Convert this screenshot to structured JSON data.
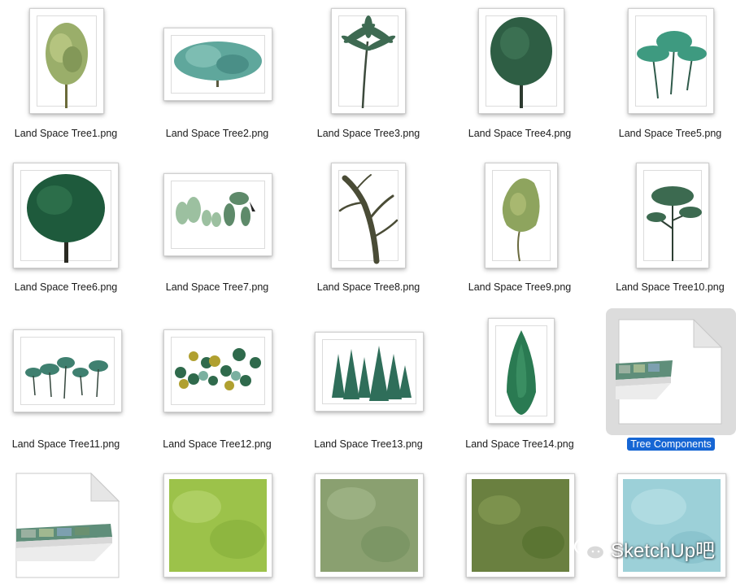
{
  "files": [
    {
      "name": "Land Space Tree1.png"
    },
    {
      "name": "Land Space Tree2.png"
    },
    {
      "name": "Land Space Tree3.png"
    },
    {
      "name": "Land Space Tree4.png"
    },
    {
      "name": "Land Space Tree5.png"
    },
    {
      "name": "Land Space Tree6.png"
    },
    {
      "name": "Land Space Tree7.png"
    },
    {
      "name": "Land Space Tree8.png"
    },
    {
      "name": "Land Space Tree9.png"
    },
    {
      "name": "Land Space Tree10.png"
    },
    {
      "name": "Land Space Tree11.png"
    },
    {
      "name": "Land Space Tree12.png"
    },
    {
      "name": "Land Space Tree13.png"
    },
    {
      "name": "Land Space Tree14.png"
    },
    {
      "name": "Tree Components",
      "selected": true
    }
  ],
  "watermark": {
    "text": "SketchUp吧"
  }
}
